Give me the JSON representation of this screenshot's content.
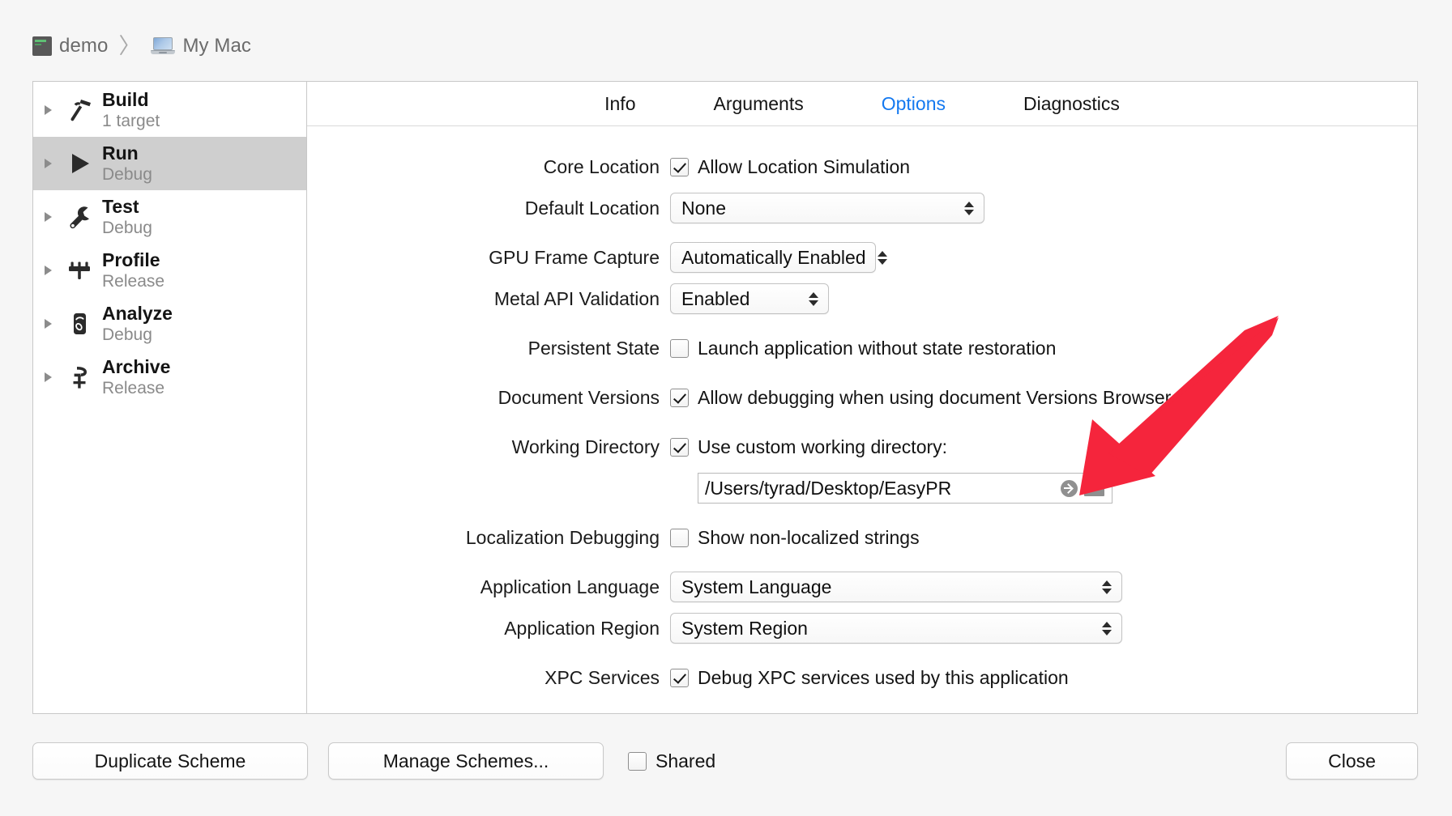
{
  "breadcrumb": {
    "project": "demo",
    "destination": "My Mac",
    "separator": "〉",
    "project_icon": "terminal-icon",
    "destination_icon": "laptop-icon"
  },
  "sidebar": {
    "items": [
      {
        "title": "Build",
        "subtitle": "1 target",
        "icon": "hammer-icon",
        "selected": false
      },
      {
        "title": "Run",
        "subtitle": "Debug",
        "icon": "play-icon",
        "selected": true
      },
      {
        "title": "Test",
        "subtitle": "Debug",
        "icon": "wrench-icon",
        "selected": false
      },
      {
        "title": "Profile",
        "subtitle": "Release",
        "icon": "gauge-icon",
        "selected": false
      },
      {
        "title": "Analyze",
        "subtitle": "Debug",
        "icon": "analyze-icon",
        "selected": false
      },
      {
        "title": "Archive",
        "subtitle": "Release",
        "icon": "archive-icon",
        "selected": false
      }
    ]
  },
  "tabs": [
    {
      "label": "Info",
      "active": false
    },
    {
      "label": "Arguments",
      "active": false
    },
    {
      "label": "Options",
      "active": true
    },
    {
      "label": "Diagnostics",
      "active": false
    }
  ],
  "options": {
    "core_location": {
      "label": "Core Location",
      "checkbox_label": "Allow Location Simulation",
      "checked": true
    },
    "default_location": {
      "label": "Default Location",
      "value": "None"
    },
    "gpu_frame_capture": {
      "label": "GPU Frame Capture",
      "value": "Automatically Enabled"
    },
    "metal_api_validation": {
      "label": "Metal API Validation",
      "value": "Enabled"
    },
    "persistent_state": {
      "label": "Persistent State",
      "checkbox_label": "Launch application without state restoration",
      "checked": false
    },
    "document_versions": {
      "label": "Document Versions",
      "checkbox_label": "Allow debugging when using document Versions Browser",
      "checked": true
    },
    "working_directory": {
      "label": "Working Directory",
      "checkbox_label": "Use custom working directory:",
      "checked": true,
      "path": "/Users/tyrad/Desktop/EasyPR",
      "reveal_icon": "reveal-in-finder-icon",
      "folder_icon": "choose-folder-icon"
    },
    "localization_debugging": {
      "label": "Localization Debugging",
      "checkbox_label": "Show non-localized strings",
      "checked": false
    },
    "application_language": {
      "label": "Application Language",
      "value": "System Language"
    },
    "application_region": {
      "label": "Application Region",
      "value": "System Region"
    },
    "xpc_services": {
      "label": "XPC Services",
      "checkbox_label": "Debug XPC services used by this application",
      "checked": true
    }
  },
  "footer": {
    "duplicate_scheme": "Duplicate Scheme",
    "manage_schemes": "Manage Schemes...",
    "shared_label": "Shared",
    "shared_checked": false,
    "close": "Close"
  },
  "annotation": {
    "type": "arrow",
    "color": "#F5253C",
    "points_to": "working-directory-path-field"
  },
  "colors": {
    "active_tab": "#1479F0",
    "selection": "#CFCFCF",
    "window_background": "#F6F6F6",
    "annotation_red": "#F5253C"
  }
}
